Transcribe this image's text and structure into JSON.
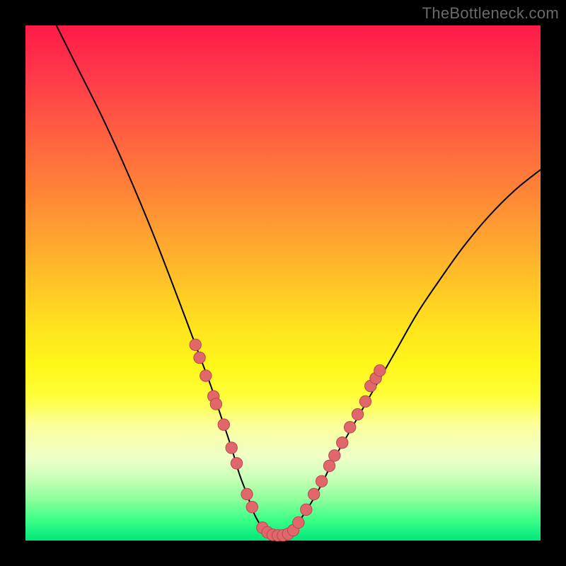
{
  "watermark": "TheBottleneck.com",
  "chart_data": {
    "type": "line",
    "title": "",
    "xlabel": "",
    "ylabel": "",
    "xlim": [
      0,
      100
    ],
    "ylim": [
      0,
      100
    ],
    "series": [
      {
        "name": "bottleneck-curve",
        "x": [
          6,
          10,
          15,
          20,
          25,
          30,
          33,
          36,
          38,
          40,
          41.5,
          43,
          44.5,
          46,
          47.5,
          49,
          50.5,
          52,
          54,
          57,
          60,
          64,
          68,
          72,
          76,
          80,
          85,
          90,
          95,
          100
        ],
        "y": [
          100,
          92,
          82,
          71,
          59,
          46,
          38,
          30,
          24,
          18,
          13,
          9,
          5,
          2.5,
          1.2,
          1,
          1.2,
          2.5,
          5,
          10,
          16,
          23,
          30,
          37,
          44,
          50,
          57,
          63,
          68,
          72
        ]
      }
    ],
    "markers": [
      {
        "side": "left",
        "x": 33.0,
        "y": 38.0
      },
      {
        "side": "left",
        "x": 33.8,
        "y": 35.5
      },
      {
        "side": "left",
        "x": 35.0,
        "y": 32.0
      },
      {
        "side": "left",
        "x": 36.5,
        "y": 28.0
      },
      {
        "side": "left",
        "x": 37.0,
        "y": 26.5
      },
      {
        "side": "left",
        "x": 38.5,
        "y": 22.5
      },
      {
        "side": "left",
        "x": 40.0,
        "y": 18.0
      },
      {
        "side": "left",
        "x": 41.0,
        "y": 15.0
      },
      {
        "side": "left",
        "x": 43.0,
        "y": 9.0
      },
      {
        "side": "left",
        "x": 44.0,
        "y": 6.5
      },
      {
        "side": "bottom",
        "x": 46.0,
        "y": 2.5
      },
      {
        "side": "bottom",
        "x": 47.0,
        "y": 1.6
      },
      {
        "side": "bottom",
        "x": 48.0,
        "y": 1.1
      },
      {
        "side": "bottom",
        "x": 49.0,
        "y": 1.0
      },
      {
        "side": "bottom",
        "x": 50.0,
        "y": 1.0
      },
      {
        "side": "bottom",
        "x": 51.0,
        "y": 1.3
      },
      {
        "side": "bottom",
        "x": 52.0,
        "y": 2.0
      },
      {
        "side": "bottom",
        "x": 53.0,
        "y": 3.5
      },
      {
        "side": "right",
        "x": 54.5,
        "y": 6.0
      },
      {
        "side": "right",
        "x": 56.0,
        "y": 9.0
      },
      {
        "side": "right",
        "x": 57.5,
        "y": 11.5
      },
      {
        "side": "right",
        "x": 59.0,
        "y": 14.5
      },
      {
        "side": "right",
        "x": 60.0,
        "y": 16.5
      },
      {
        "side": "right",
        "x": 61.5,
        "y": 19.0
      },
      {
        "side": "right",
        "x": 63.0,
        "y": 22.0
      },
      {
        "side": "right",
        "x": 64.5,
        "y": 24.5
      },
      {
        "side": "right",
        "x": 66.0,
        "y": 27.0
      },
      {
        "side": "right",
        "x": 67.0,
        "y": 30.0
      },
      {
        "side": "right",
        "x": 68.0,
        "y": 31.5
      },
      {
        "side": "right",
        "x": 68.8,
        "y": 33.0
      }
    ],
    "marker_style": {
      "r": 8.2,
      "fill": "#e2676b",
      "stroke": "#b34a50"
    },
    "curve_style": {
      "stroke": "#000000",
      "width": 2.0
    }
  }
}
